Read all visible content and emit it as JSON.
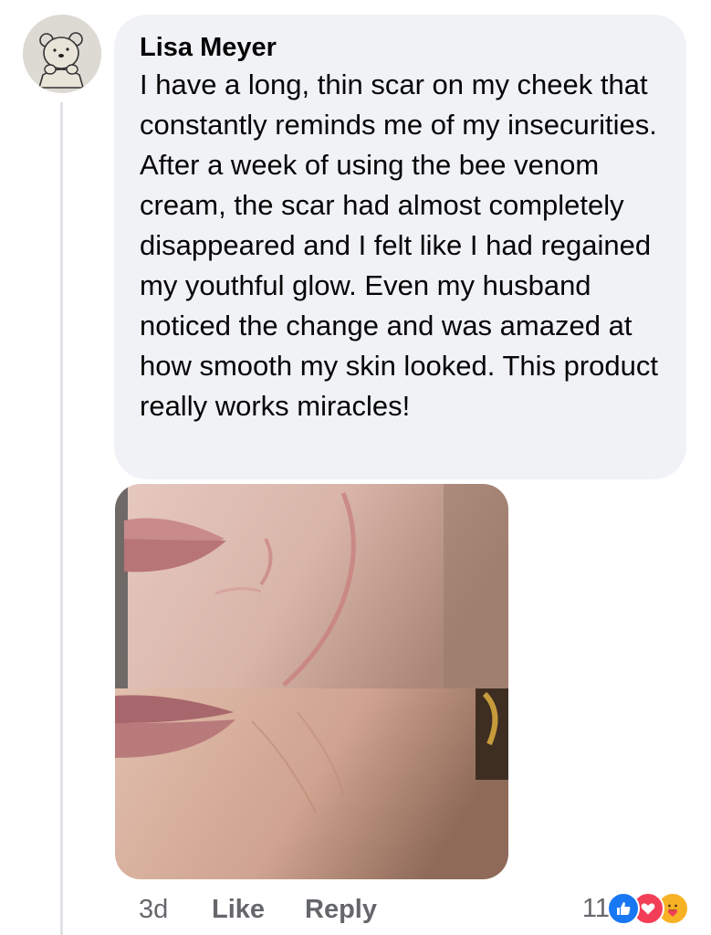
{
  "comment": {
    "author": "Lisa Meyer",
    "text": "I have a long, thin scar on my cheek that constantly reminds me of my insecurities. After a week of using the bee venom cream, the scar had almost completely disappeared and I felt like I had regained my youthful glow. Even my husband noticed the change and was amazed at how smooth my skin looked. This product really works miracles!",
    "avatar_icon": "cartoon-bear-icon",
    "photo": "before-after-cheek-scar-photo"
  },
  "actions": {
    "time": "3d",
    "like_label": "Like",
    "reply_label": "Reply"
  },
  "reactions": {
    "count": "11",
    "icons": [
      "like-reaction-icon",
      "love-reaction-icon",
      "care-reaction-icon"
    ],
    "colors": {
      "like": "#1877f2",
      "love": "#f33e58",
      "care": "#f7b125"
    }
  },
  "colors": {
    "bubble_bg": "#f0f2f5",
    "text": "#050505",
    "secondary_text": "#65676b",
    "thread_line": "#dfe1e5"
  }
}
